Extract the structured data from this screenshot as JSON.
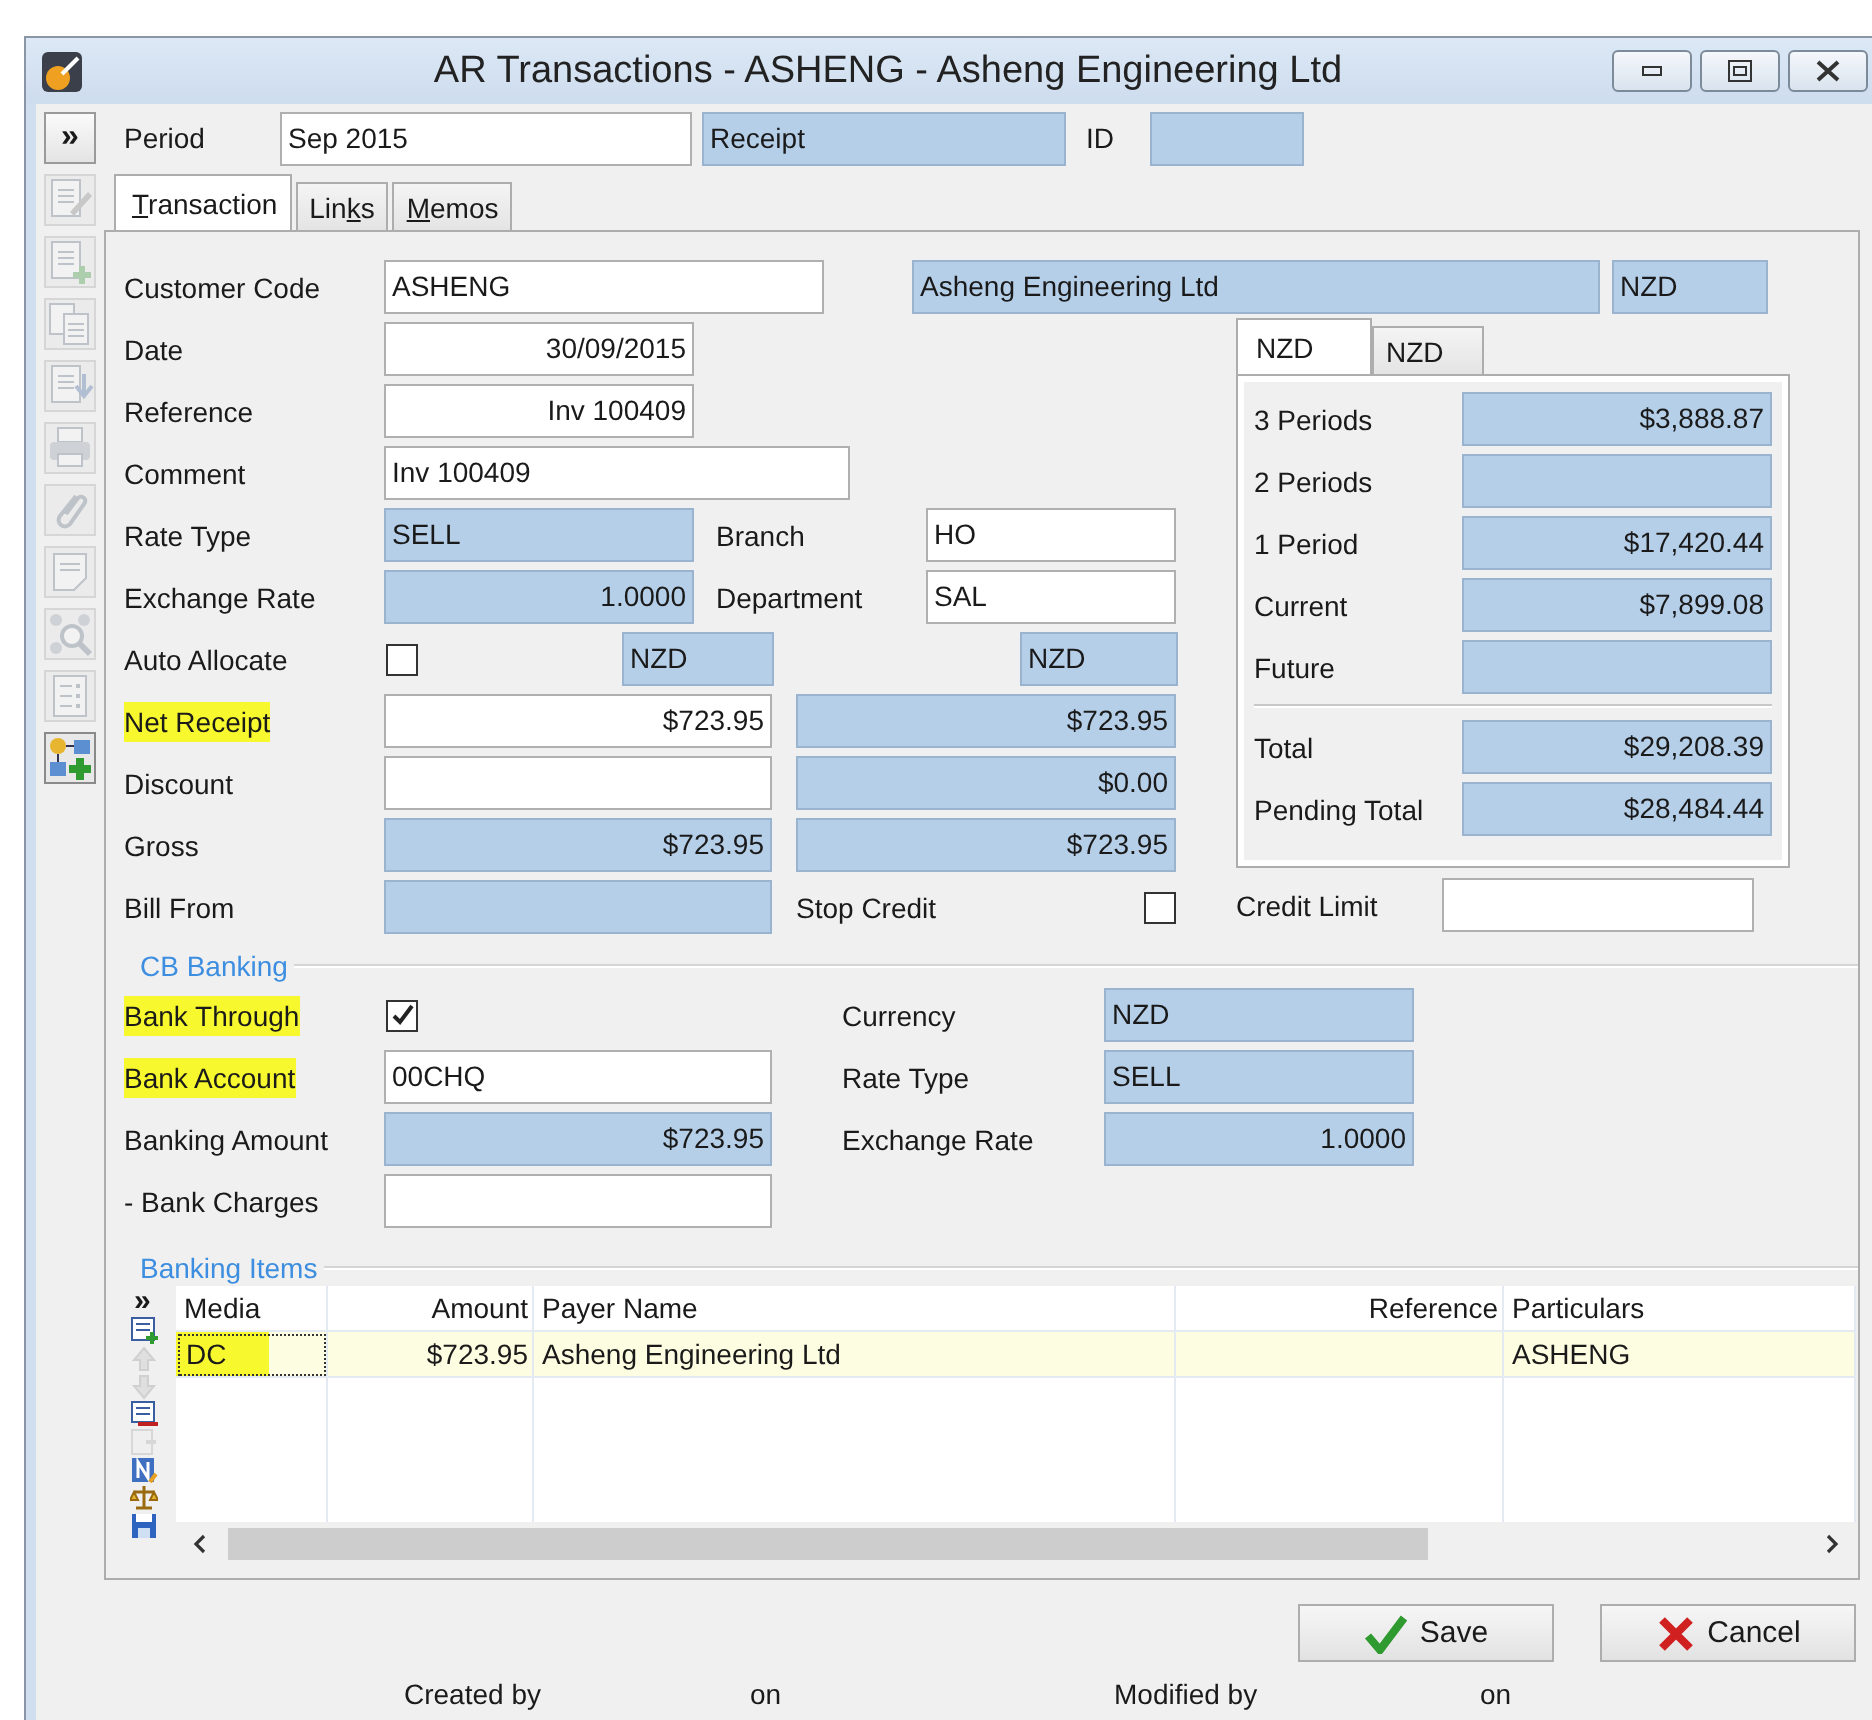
{
  "window": {
    "title": "AR Transactions - ASHENG - Asheng Engineering Ltd"
  },
  "toolbar": {
    "expand": "»",
    "buttons": [
      {
        "kind": "edit",
        "disabled": true
      },
      {
        "kind": "new",
        "disabled": true
      },
      {
        "kind": "copy",
        "disabled": true
      },
      {
        "kind": "import",
        "disabled": true
      },
      {
        "kind": "print",
        "disabled": true
      },
      {
        "kind": "attach",
        "disabled": true
      },
      {
        "kind": "note",
        "disabled": true
      },
      {
        "kind": "find",
        "disabled": true
      },
      {
        "kind": "list",
        "disabled": true
      },
      {
        "kind": "add_node",
        "disabled": false
      }
    ]
  },
  "header": {
    "period_label": "Period",
    "period": "Sep 2015",
    "type": "Receipt",
    "id_label": "ID"
  },
  "tabs": [
    {
      "key": "T",
      "after": "ransaction",
      "selected": true
    },
    {
      "before": "Lin",
      "key": "k",
      "after": "s",
      "selected": false
    },
    {
      "key": "M",
      "after": "emos",
      "selected": false
    }
  ],
  "customer": {
    "label": "Customer Code",
    "code": "ASHENG",
    "name": "Asheng Engineering Ltd",
    "currency": "NZD"
  },
  "transaction": {
    "rows": [
      {
        "kind": "date",
        "label": "Date",
        "value": "30/09/2015",
        "highlighted": false
      },
      {
        "kind": "reference",
        "label": "Reference",
        "value": "Inv 100409",
        "highlighted": false
      },
      {
        "kind": "comment",
        "label": "Comment",
        "value": "Inv 100409",
        "highlighted": false
      },
      {
        "kind": "rate_type",
        "label": "Rate Type",
        "value": "SELL",
        "side_label": "Branch",
        "side_value": "HO",
        "highlighted": false
      },
      {
        "kind": "exchange_rate",
        "label": "Exchange Rate",
        "value": "1.0000",
        "side_label": "Department",
        "side_value": "SAL",
        "highlighted": false
      },
      {
        "kind": "auto_allocate",
        "label": "Auto Allocate",
        "checked": false,
        "currency": "NZD",
        "base_currency": "NZD",
        "highlighted": false
      },
      {
        "kind": "amount",
        "label": "Net Receipt",
        "value": "$723.95",
        "base_value": "$723.95",
        "editable": true,
        "highlighted": true
      },
      {
        "kind": "amount",
        "label": "Discount",
        "base_value": "$0.00",
        "editable": true,
        "highlighted": false
      },
      {
        "kind": "amount",
        "label": "Gross",
        "value": "$723.95",
        "base_value": "$723.95",
        "editable": false,
        "highlighted": false
      },
      {
        "kind": "bill_from",
        "label": "Bill From",
        "side_label": "Stop Credit",
        "checked": false,
        "highlighted": false
      }
    ]
  },
  "aging": {
    "tabs": [
      {
        "label": "NZD",
        "selected": true
      },
      {
        "label": "NZD",
        "selected": false
      }
    ],
    "rows": [
      {
        "kind": "bucket",
        "label": "3 Periods",
        "value": "$3,888.87"
      },
      {
        "kind": "bucket",
        "label": "2 Periods"
      },
      {
        "kind": "bucket",
        "label": "1 Period",
        "value": "$17,420.44"
      },
      {
        "kind": "bucket",
        "label": "Current",
        "value": "$7,899.08"
      },
      {
        "kind": "bucket",
        "label": "Future"
      },
      {
        "kind": "total",
        "label": "Total",
        "value": "$29,208.39"
      },
      {
        "kind": "total",
        "label": "Pending Total",
        "value": "$28,484.44"
      }
    ],
    "credit_limit_label": "Credit Limit"
  },
  "banking": {
    "title": "CB Banking",
    "rows": [
      {
        "kind": "check",
        "label": "Bank Through",
        "checked": true,
        "highlighted": true,
        "side_label": "Currency",
        "side_value": "NZD"
      },
      {
        "kind": "text",
        "label": "Bank Account",
        "value": "00CHQ",
        "highlighted": true,
        "side_label": "Rate Type",
        "side_value": "SELL"
      },
      {
        "kind": "amount",
        "label": "Banking Amount",
        "value": "$723.95",
        "highlighted": false,
        "side_label": "Exchange Rate",
        "side_value": "1.0000"
      },
      {
        "kind": "entry",
        "label": "- Bank Charges",
        "highlighted": false
      }
    ]
  },
  "banking_items": {
    "title": "Banking Items",
    "expand": "»",
    "tools": [
      {
        "kind": "add_row",
        "disabled": false
      },
      {
        "kind": "up",
        "disabled": true
      },
      {
        "kind": "down",
        "disabled": true
      },
      {
        "kind": "delete_row",
        "disabled": false
      },
      {
        "kind": "move",
        "disabled": true
      },
      {
        "kind": "code",
        "disabled": false
      },
      {
        "kind": "balance",
        "disabled": false
      },
      {
        "kind": "save",
        "disabled": false
      }
    ],
    "columns": [
      "Media",
      "Amount",
      "Payer Name",
      "Reference",
      "Particulars"
    ],
    "rows": [
      {
        "selected": true,
        "highlighted": true,
        "cells": [
          "DC",
          "$723.95",
          "Asheng Engineering Ltd",
          null,
          "ASHENG"
        ]
      }
    ]
  },
  "buttons": [
    {
      "kind": "save",
      "label": "Save"
    },
    {
      "kind": "cancel",
      "label": "Cancel"
    }
  ],
  "audit": {
    "created_label": "Created by",
    "created_on_label": "on",
    "modified_label": "Modified by",
    "modified_on_label": "on"
  }
}
